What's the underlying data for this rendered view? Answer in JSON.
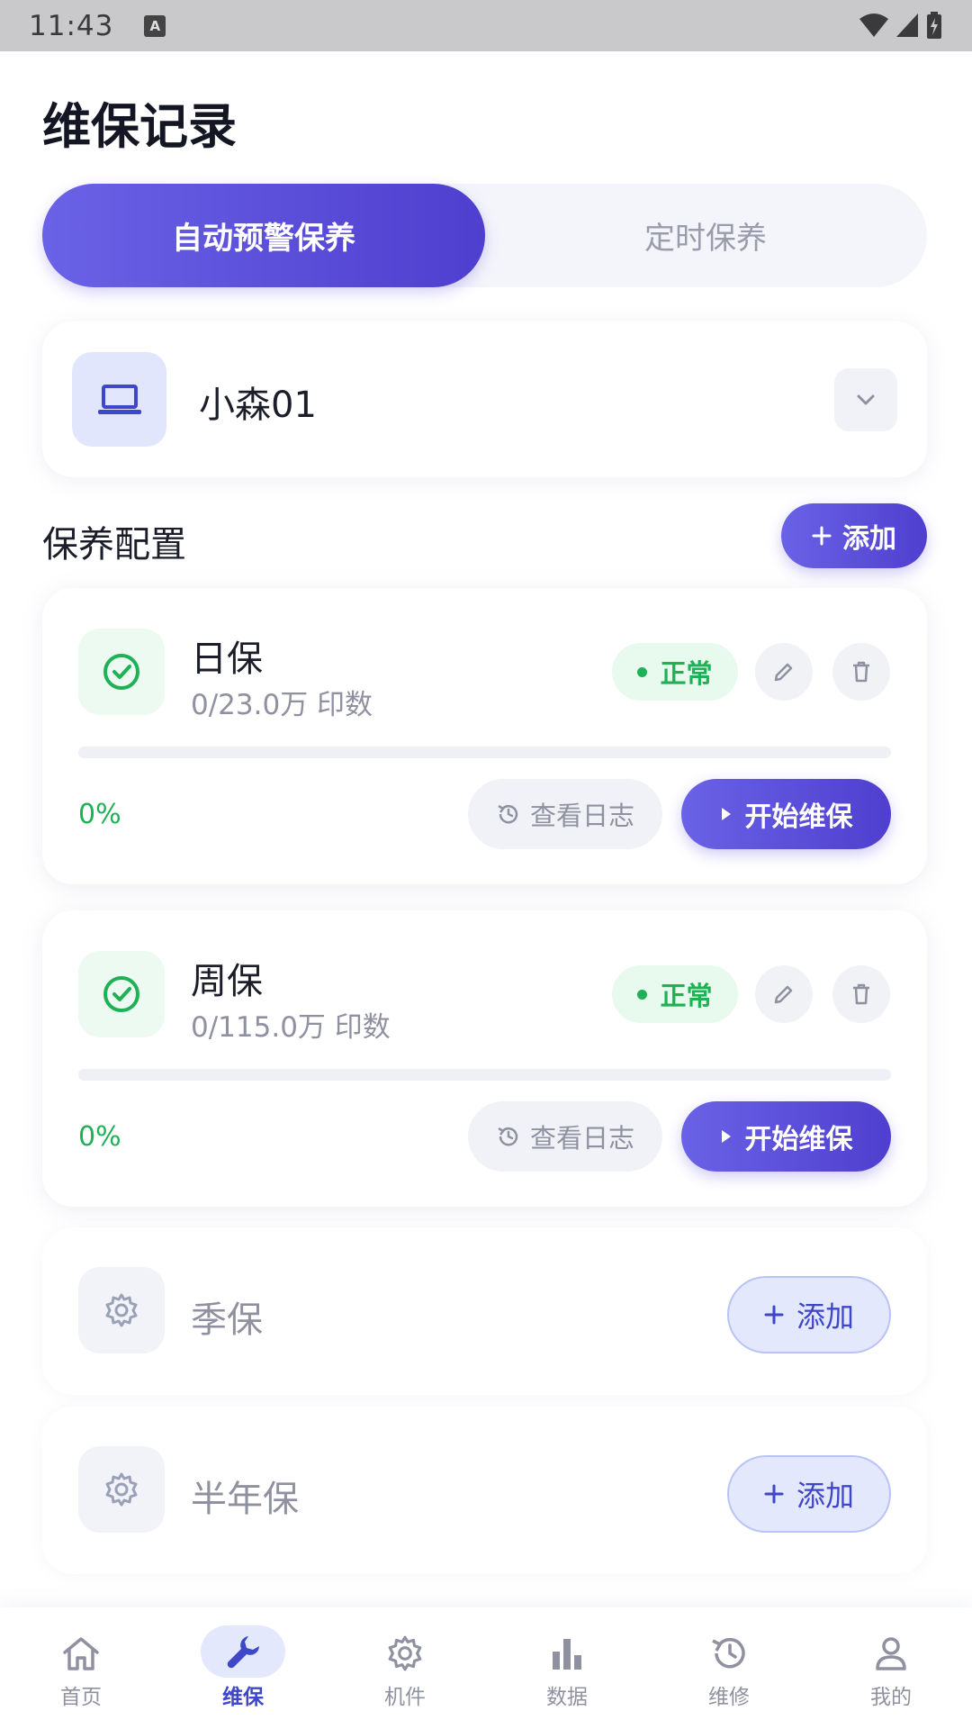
{
  "status_bar": {
    "time": "11:43",
    "notification_letter": "A"
  },
  "page": {
    "title": "维保记录"
  },
  "tabs": [
    {
      "label": "自动预警保养",
      "active": true
    },
    {
      "label": "定时保养",
      "active": false
    }
  ],
  "device": {
    "name": "小森01",
    "icon": "laptop-icon"
  },
  "section": {
    "title": "保养配置",
    "add_label": "添加"
  },
  "plans": [
    {
      "name": "日保",
      "usage": "0/23.0万 印数",
      "status": "正常",
      "progress": 0,
      "percent_label": "0%",
      "log_label": "查看日志",
      "start_label": "开始维保"
    },
    {
      "name": "周保",
      "usage": "0/115.0万 印数",
      "status": "正常",
      "progress": 0,
      "percent_label": "0%",
      "log_label": "查看日志",
      "start_label": "开始维保"
    }
  ],
  "empty_plans": [
    {
      "name": "季保",
      "add_label": "添加"
    },
    {
      "name": "半年保",
      "add_label": "添加"
    }
  ],
  "colors": {
    "accent": "#5b4fdc",
    "success": "#1fb155",
    "muted": "#8f91a0"
  },
  "bottom_nav": [
    {
      "label": "首页",
      "icon": "home-icon",
      "active": false
    },
    {
      "label": "维保",
      "icon": "wrench-icon",
      "active": true
    },
    {
      "label": "机件",
      "icon": "gear-icon",
      "active": false
    },
    {
      "label": "数据",
      "icon": "bar-chart-icon",
      "active": false
    },
    {
      "label": "维修",
      "icon": "history-icon",
      "active": false
    },
    {
      "label": "我的",
      "icon": "person-icon",
      "active": false
    }
  ]
}
